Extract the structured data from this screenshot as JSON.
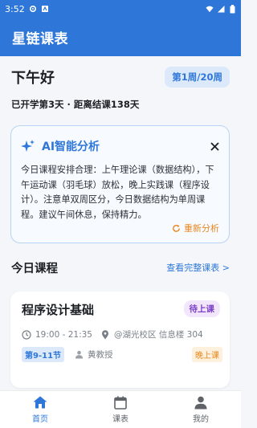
{
  "status_bar": {
    "time": "3:52"
  },
  "app_bar": {
    "title": "星链课表"
  },
  "home": {
    "greeting": "下午好",
    "week_badge": "第1周/20周",
    "semester_info": "已开学第3天 · 距离结课138天"
  },
  "ai_card": {
    "title": "AI智能分析",
    "body": "今日课程安排合理：上午理论课（数据结构），下午运动课（羽毛球）放松，晚上实践课（程序设计）。注意单双周区分，今日数据结构为单周课程。建议午间休息，保持精力。",
    "reanalyze_label": "重新分析"
  },
  "today": {
    "section_title": "今日课程",
    "view_all_label": "查看完整课表 >",
    "courses": [
      {
        "name": "程序设计基础",
        "status": "待上课",
        "time": "19:00 - 21:35",
        "location": "@湖光校区 信息楼 304",
        "periods": "第9-11节",
        "teacher": "黄教授",
        "time_of_day": "晚上课"
      }
    ]
  },
  "bottom_nav": {
    "items": [
      {
        "label": "首页",
        "icon": "home-icon",
        "active": true
      },
      {
        "label": "课表",
        "icon": "calendar-icon",
        "active": false
      },
      {
        "label": "我的",
        "icon": "person-icon",
        "active": false
      }
    ]
  },
  "colors": {
    "primary": "#2e77d8",
    "accent_orange": "#e8871e",
    "badge_purple": "#7b3fc4",
    "background": "#f4f6fa"
  }
}
